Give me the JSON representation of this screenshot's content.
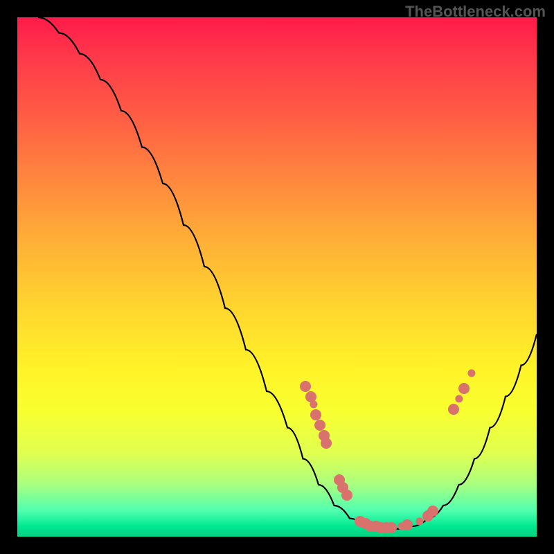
{
  "watermark": "TheBottleneck.com",
  "chart_data": {
    "type": "line",
    "title": "",
    "xlabel": "",
    "ylabel": "",
    "xlim": [
      0,
      100
    ],
    "ylim": [
      0,
      100
    ],
    "curve": [
      {
        "x": 4,
        "y": 100
      },
      {
        "x": 8,
        "y": 97
      },
      {
        "x": 12,
        "y": 93
      },
      {
        "x": 16,
        "y": 88
      },
      {
        "x": 20,
        "y": 82
      },
      {
        "x": 24,
        "y": 75
      },
      {
        "x": 28,
        "y": 68
      },
      {
        "x": 32,
        "y": 60
      },
      {
        "x": 36,
        "y": 52
      },
      {
        "x": 40,
        "y": 44
      },
      {
        "x": 44,
        "y": 36
      },
      {
        "x": 48,
        "y": 28
      },
      {
        "x": 52,
        "y": 21
      },
      {
        "x": 55,
        "y": 15
      },
      {
        "x": 58,
        "y": 10
      },
      {
        "x": 61,
        "y": 6
      },
      {
        "x": 64,
        "y": 3.5
      },
      {
        "x": 67,
        "y": 2
      },
      {
        "x": 70,
        "y": 1.5
      },
      {
        "x": 73,
        "y": 1.5
      },
      {
        "x": 76,
        "y": 2
      },
      {
        "x": 79,
        "y": 3.5
      },
      {
        "x": 82,
        "y": 6
      },
      {
        "x": 85,
        "y": 10
      },
      {
        "x": 88,
        "y": 15
      },
      {
        "x": 91,
        "y": 21
      },
      {
        "x": 94,
        "y": 27
      },
      {
        "x": 97,
        "y": 33
      },
      {
        "x": 100,
        "y": 39
      }
    ],
    "markers": [
      {
        "x": 55.5,
        "y": 29,
        "r": 5
      },
      {
        "x": 56.5,
        "y": 27,
        "r": 5
      },
      {
        "x": 57.0,
        "y": 25.5,
        "r": 3.5
      },
      {
        "x": 57.5,
        "y": 23.5,
        "r": 5
      },
      {
        "x": 58.3,
        "y": 21.5,
        "r": 5
      },
      {
        "x": 59.0,
        "y": 19.5,
        "r": 5
      },
      {
        "x": 59.5,
        "y": 18,
        "r": 5
      },
      {
        "x": 62.0,
        "y": 11,
        "r": 5
      },
      {
        "x": 62.7,
        "y": 9.5,
        "r": 5
      },
      {
        "x": 63.5,
        "y": 8,
        "r": 5
      },
      {
        "x": 66.0,
        "y": 3.0,
        "r": 5
      },
      {
        "x": 67.0,
        "y": 2.5,
        "r": 5
      },
      {
        "x": 68.0,
        "y": 2.0,
        "r": 5
      },
      {
        "x": 69.0,
        "y": 2.0,
        "r": 5
      },
      {
        "x": 70.0,
        "y": 1.8,
        "r": 5
      },
      {
        "x": 71.0,
        "y": 1.8,
        "r": 5
      },
      {
        "x": 72.0,
        "y": 1.8,
        "r": 5
      },
      {
        "x": 74.0,
        "y": 2.0,
        "r": 3.5
      },
      {
        "x": 75.0,
        "y": 2.3,
        "r": 5
      },
      {
        "x": 77.5,
        "y": 3.0,
        "r": 3.5
      },
      {
        "x": 79.0,
        "y": 4.0,
        "r": 5
      },
      {
        "x": 80.0,
        "y": 5.0,
        "r": 5
      },
      {
        "x": 84.0,
        "y": 24.5,
        "r": 5
      },
      {
        "x": 85.0,
        "y": 26.5,
        "r": 3.5
      },
      {
        "x": 86.0,
        "y": 28.5,
        "r": 5
      },
      {
        "x": 87.5,
        "y": 31.5,
        "r": 3.5
      }
    ]
  }
}
